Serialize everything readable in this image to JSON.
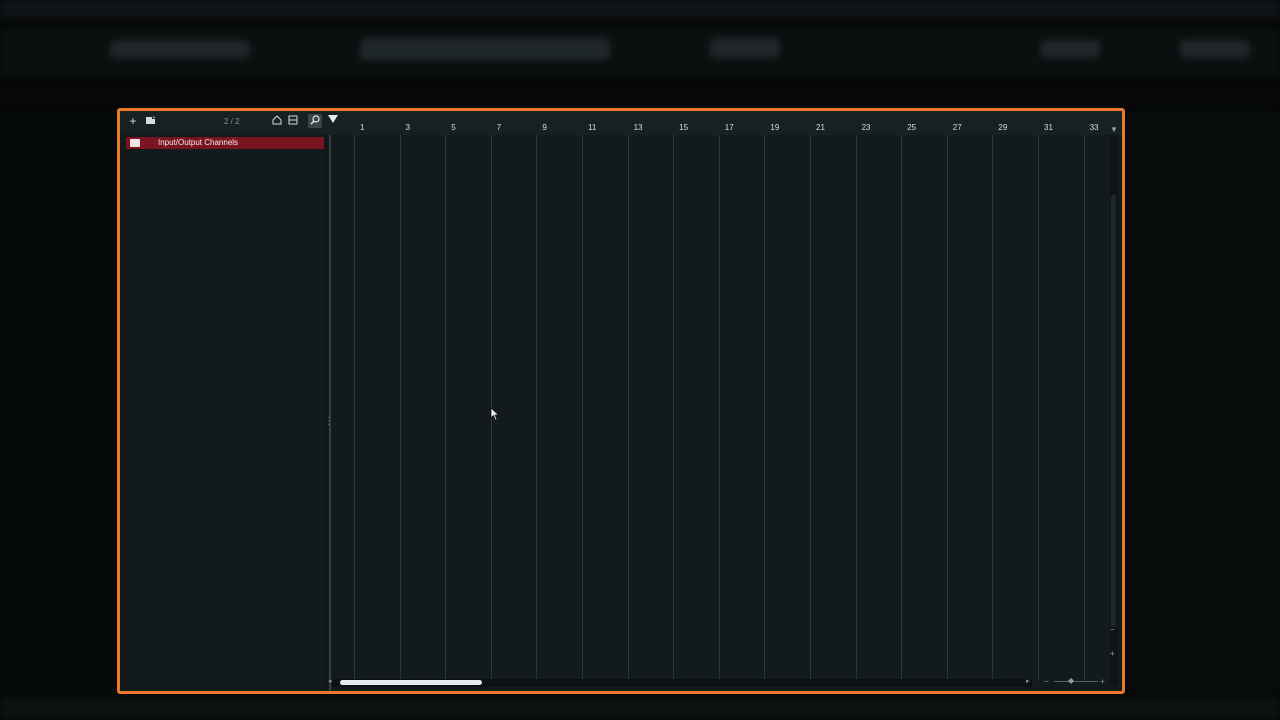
{
  "toolbar": {
    "add_icon": "plus-icon",
    "add_folder_icon": "add-group-icon",
    "track_count": "2 / 2",
    "home_icon": "home-icon",
    "list_icon": "list-icon",
    "search_icon": "search-icon"
  },
  "tracks": [
    {
      "name": "Input/Output Channels",
      "icon": "folder-icon",
      "color": "#7a1420"
    }
  ],
  "ruler": {
    "bars": [
      "1",
      "3",
      "5",
      "7",
      "9",
      "11",
      "13",
      "15",
      "17",
      "19",
      "21",
      "23",
      "25",
      "27",
      "29",
      "31",
      "33"
    ]
  },
  "colors": {
    "highlight_border": "#ea7a2a",
    "background": "#121a1b",
    "gridline": "#2c3737"
  },
  "scroll": {
    "horizontal_position": 0.0,
    "horizontal_visible_fraction": 0.2
  }
}
